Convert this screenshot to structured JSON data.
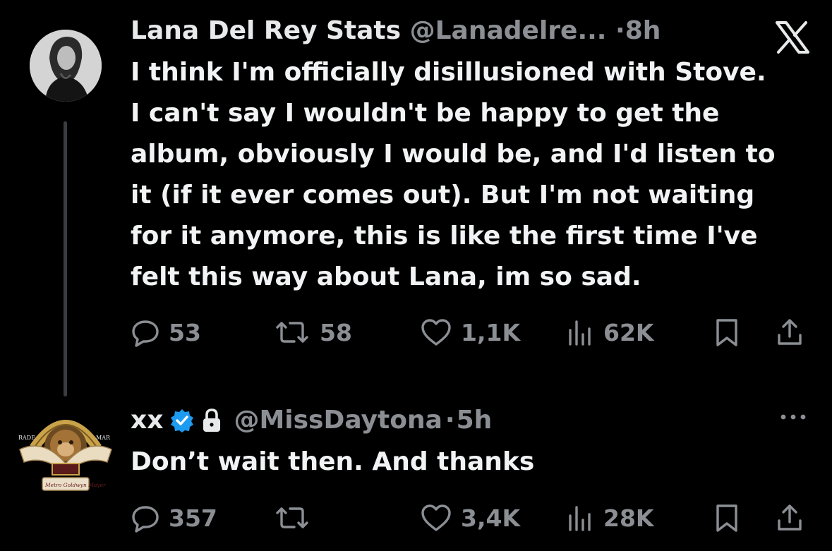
{
  "platform": {
    "logo_icon": "x-logo-icon"
  },
  "post": {
    "author": "Lana Del Rey Stats",
    "handle": "@Lanadelre...",
    "separator": "·",
    "time": "8h",
    "text": "I think I'm officially disillusioned with Stove.\nI can't say I wouldn't be happy to get the\nalbum, obviously I would be, and I'd listen to\nit (if it ever comes out). But I'm not waiting\nfor it anymore, this is like the first time I've\nfelt this way about Lana, im so sad.",
    "stats": {
      "replies": "53",
      "reposts": "58",
      "likes": "1,1K",
      "views": "62K"
    }
  },
  "reply": {
    "author": "xx",
    "verified": true,
    "locked": true,
    "handle": "@MissDaytona",
    "separator": "·",
    "time": "5h",
    "text": "Don’t wait then. And thanks",
    "stats": {
      "replies": "357",
      "reposts": "",
      "likes": "3,4K",
      "views": "28K"
    },
    "avatar_text": {
      "left": "RADE",
      "right": "MAR",
      "script": "Metro Goldwyn Mayer"
    }
  },
  "colors": {
    "background": "#000000",
    "text": "#e7e9ea",
    "muted": "#8b8f94",
    "verified": "#1d9bf0",
    "thread_line": "#3a3d40"
  }
}
